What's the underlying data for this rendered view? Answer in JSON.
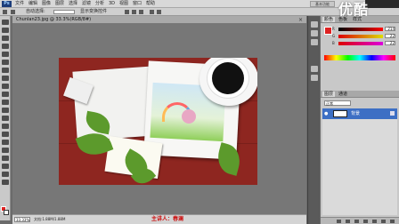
{
  "app": {
    "logo": "Ps",
    "menu": [
      "文件",
      "编辑",
      "图像",
      "图层",
      "选择",
      "滤镜",
      "分析",
      "3D",
      "视图",
      "窗口",
      "帮助"
    ],
    "workspace": "基本功能"
  },
  "options": {
    "auto_select_label": "自动选择:",
    "auto_select_value": "组",
    "show_transform_label": "显示变换控件"
  },
  "watermark": "优酷",
  "document": {
    "tab_title": "Chunlan23.jpg @ 33.3%(RGB/8#)",
    "close_glyph": "×"
  },
  "status": {
    "zoom": "33.33%",
    "doc_info": "文档:1.88M/1.88M",
    "presenter": "主讲人：春澜"
  },
  "panels": {
    "color_tab": "颜色",
    "swatches_tab": "色板",
    "styles_tab": "样式",
    "sliders": [
      {
        "label": "R",
        "value": "214"
      },
      {
        "label": "G",
        "value": "22"
      },
      {
        "label": "B",
        "value": "22"
      }
    ],
    "layers_tab": "图层",
    "channels_tab": "通道",
    "blend_mode": "正常",
    "layer_name": "背景"
  },
  "colors": {
    "foreground": "#d22222",
    "background": "#ffffff",
    "selected_layer": "#3d6fc4",
    "artwork_bg": "#8e2620",
    "presenter_text": "#cc1111"
  }
}
